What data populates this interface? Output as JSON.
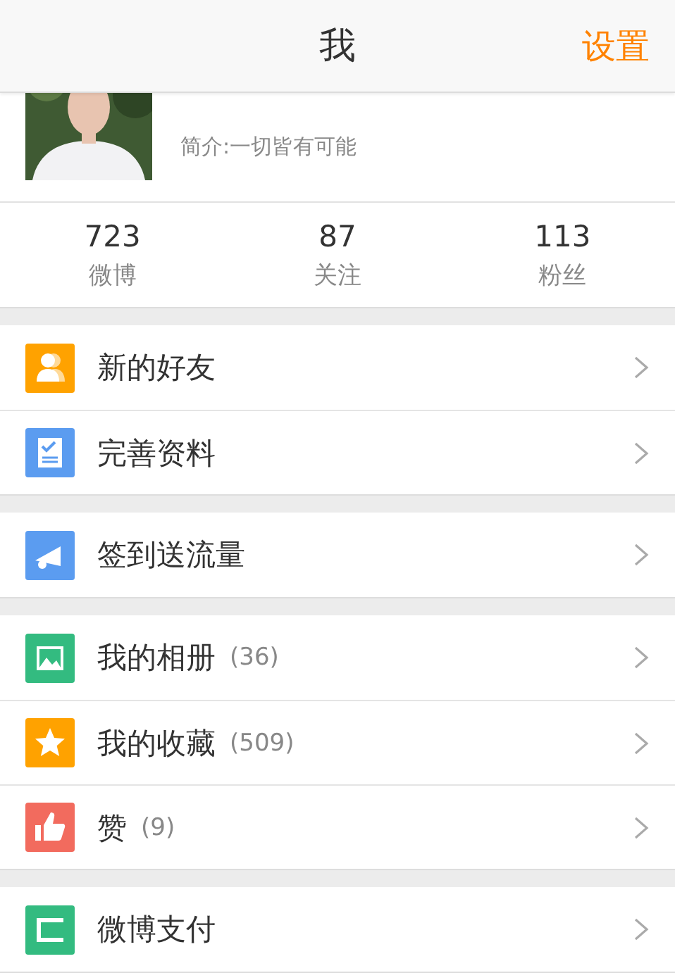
{
  "header": {
    "title": "我",
    "action": "设置"
  },
  "profile": {
    "intro": "简介:一切皆有可能"
  },
  "stats": [
    {
      "value": "723",
      "label": "微博"
    },
    {
      "value": "87",
      "label": "关注"
    },
    {
      "value": "113",
      "label": "粉丝"
    }
  ],
  "sections": [
    {
      "items": [
        {
          "kind": "friends",
          "label": "新的好友",
          "color": "#ffa200"
        },
        {
          "kind": "profile",
          "label": "完善资料",
          "color": "#5b9cf0"
        }
      ]
    },
    {
      "items": [
        {
          "kind": "megaphone",
          "label": "签到送流量",
          "color": "#5b9cf0"
        }
      ]
    },
    {
      "items": [
        {
          "kind": "album",
          "label": "我的相册",
          "count": "(36)",
          "color": "#33bb80"
        },
        {
          "kind": "star",
          "label": "我的收藏",
          "count": "(509)",
          "color": "#ffa200"
        },
        {
          "kind": "like",
          "label": "赞",
          "count": "(9)",
          "color": "#f26b5e"
        }
      ]
    },
    {
      "items": [
        {
          "kind": "pay",
          "label": "微博支付",
          "color": "#33bb80"
        }
      ]
    }
  ]
}
